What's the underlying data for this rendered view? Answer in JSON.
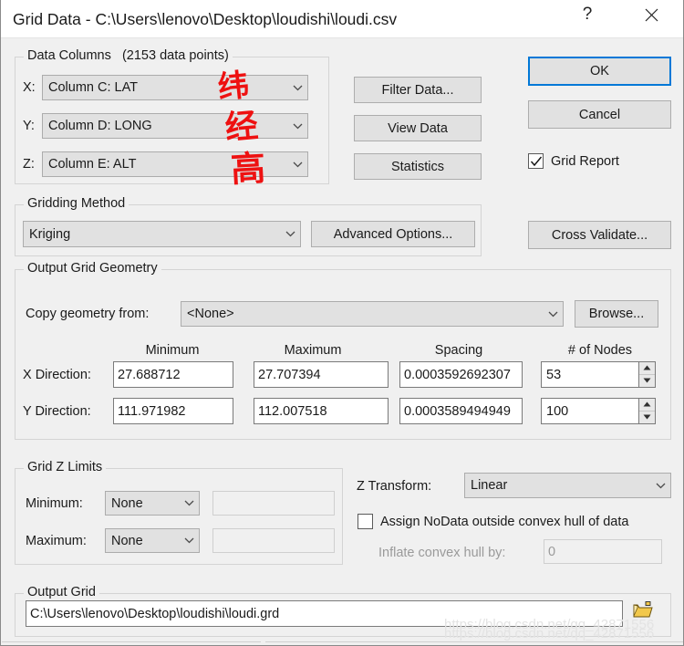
{
  "window": {
    "title": "Grid Data - C:\\Users\\lenovo\\Desktop\\loudishi\\loudi.csv",
    "help_label": "?",
    "close_icon": "close-icon",
    "bg_color": "#f0f0f0",
    "accent_color": "#0078d7"
  },
  "data_columns": {
    "group_title": "Data Columns",
    "point_count_text": "(2153 data points)",
    "rows": [
      {
        "axis_label": "X:",
        "value": "Column C:  LAT",
        "annotation": "纬"
      },
      {
        "axis_label": "Y:",
        "value": "Column D:  LONG",
        "annotation": "经"
      },
      {
        "axis_label": "Z:",
        "value": "Column E:  ALT",
        "annotation": "高"
      }
    ],
    "buttons": [
      {
        "label": "Filter Data..."
      },
      {
        "label": "View Data"
      },
      {
        "label": "Statistics"
      }
    ]
  },
  "right_panel": {
    "ok_label": "OK",
    "cancel_label": "Cancel",
    "grid_report_label": "Grid Report",
    "grid_report_checked": true,
    "cross_validate_label": "Cross Validate..."
  },
  "gridding_method": {
    "group_title": "Gridding Method",
    "selected": "Kriging",
    "advanced_options_label": "Advanced Options..."
  },
  "output_grid_geometry": {
    "group_title": "Output Grid Geometry",
    "copy_geometry_label": "Copy geometry from:",
    "copy_geometry_value": "<None>",
    "browse_label": "Browse...",
    "column_headers": [
      "Minimum",
      "Maximum",
      "Spacing",
      "# of Nodes"
    ],
    "rows": [
      {
        "label": "X Direction:",
        "minimum": "27.688712",
        "maximum": "27.707394",
        "spacing": "0.0003592692307",
        "nodes": "53"
      },
      {
        "label": "Y Direction:",
        "minimum": "111.971982",
        "maximum": "112.007518",
        "spacing": "0.0003589494949",
        "nodes": "100"
      }
    ]
  },
  "grid_z_limits": {
    "group_title": "Grid Z Limits",
    "minimum_label": "Minimum:",
    "minimum_mode": "None",
    "minimum_value": "",
    "maximum_label": "Maximum:",
    "maximum_mode": "None",
    "maximum_value": ""
  },
  "z_transform": {
    "label": "Z Transform:",
    "selected": "Linear",
    "assign_nodata_label": "Assign NoData outside convex hull of data",
    "assign_nodata_checked": false,
    "inflate_label": "Inflate convex hull by:",
    "inflate_value": "0"
  },
  "output_grid": {
    "group_title": "Output Grid",
    "path": "C:\\Users\\lenovo\\Desktop\\loudishi\\loudi.grd",
    "browse_icon": "open-folder-icon"
  },
  "watermark": {
    "text": "https://blog.csdn.net/qq_42871556"
  }
}
